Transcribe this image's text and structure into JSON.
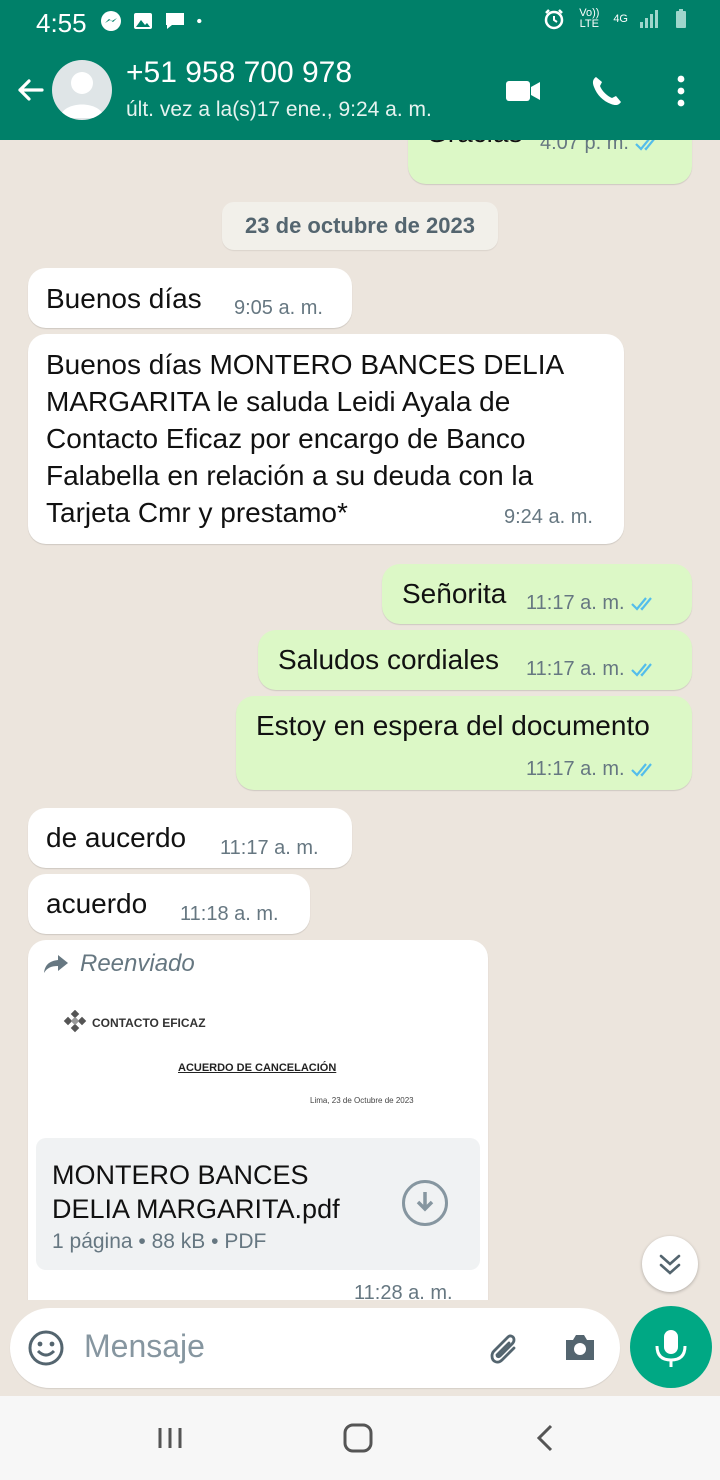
{
  "status_bar": {
    "time": "4:55",
    "network_volte": "Vo)) LTE",
    "network_type": "4G"
  },
  "header": {
    "contact_name": "+51 958 700 978",
    "last_seen": "últ. vez a la(s)17 ene., 9:24 a. m."
  },
  "chat": {
    "date_separator": "23 de octubre de 2023",
    "messages": [
      {
        "direction": "out",
        "text": "Gracias",
        "time": "4:07 p. m.",
        "read": true
      },
      {
        "direction": "in",
        "text": "Buenos días",
        "time": "9:05 a. m."
      },
      {
        "direction": "in",
        "text": "Buenos días MONTERO BANCES DELIA MARGARITA le saluda Leidi Ayala de Contacto Eficaz por encargo de Banco Falabella en relación a su deuda con la Tarjeta Cmr y prestamo*",
        "time": "9:24 a. m."
      },
      {
        "direction": "out",
        "text": "Señorita",
        "time": "11:17 a. m.",
        "read": true
      },
      {
        "direction": "out",
        "text": "Saludos cordiales",
        "time": "11:17 a. m.",
        "read": true
      },
      {
        "direction": "out",
        "text": "Estoy en espera del documento",
        "time": "11:17 a. m.",
        "read": true
      },
      {
        "direction": "in",
        "text": "de aucerdo",
        "time": "11:17 a. m."
      },
      {
        "direction": "in",
        "text": "acuerdo",
        "time": "11:18 a. m."
      }
    ],
    "document": {
      "forwarded_label": "Reenviado",
      "preview_logo_text": "CONTACTO EFICAZ",
      "preview_title": "ACUERDO DE CANCELACIÓN",
      "preview_date": "Lima, 23 de Octubre de 2023",
      "file_name": "MONTERO BANCES DELIA MARGARITA.pdf",
      "pages": "1 página",
      "size": "88 kB",
      "type": "PDF",
      "time": "11:28 a. m."
    }
  },
  "input": {
    "placeholder": "Mensaje"
  },
  "colors": {
    "header": "#008069",
    "outgoing_bubble": "#dcf8c6",
    "incoming_bubble": "#ffffff",
    "read_ticks": "#53bdeb",
    "mic_button": "#00a884",
    "chat_background": "#ece5dd"
  },
  "icons": {
    "back": "arrow-left-icon",
    "video": "video-camera-icon",
    "call": "phone-icon",
    "menu": "more-vertical-icon",
    "emoji": "emoji-icon",
    "attach": "paperclip-icon",
    "camera": "camera-icon",
    "mic": "microphone-icon",
    "scroll": "double-chevron-down-icon",
    "download": "download-icon",
    "forward": "forward-arrow-icon"
  }
}
